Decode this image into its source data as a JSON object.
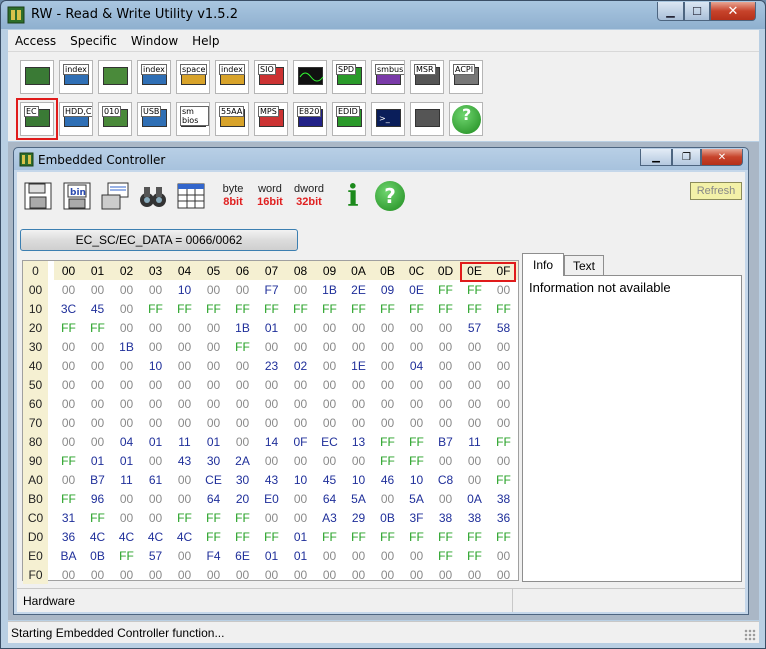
{
  "window": {
    "title": "RW - Read & Write Utility v1.5.2"
  },
  "menu": [
    "Access",
    "Specific",
    "Window",
    "Help"
  ],
  "toolbar": {
    "row1": [
      {
        "name": "pci",
        "label": ""
      },
      {
        "name": "pci-index",
        "label": "index"
      },
      {
        "name": "memory",
        "label": ""
      },
      {
        "name": "memory-index",
        "label": "index"
      },
      {
        "name": "io-space",
        "label": "space"
      },
      {
        "name": "io-index",
        "label": "index"
      },
      {
        "name": "superio",
        "label": "SIO"
      },
      {
        "name": "oscilloscope",
        "label": ""
      },
      {
        "name": "spd",
        "label": "SPD"
      },
      {
        "name": "smbus",
        "label": "smbus"
      },
      {
        "name": "msr",
        "label": "MSR"
      },
      {
        "name": "acpi",
        "label": "ACPI"
      }
    ],
    "row2": [
      {
        "name": "ec",
        "label": "EC"
      },
      {
        "name": "hdd-cd",
        "label": "HDD,CD"
      },
      {
        "name": "disk",
        "label": "010"
      },
      {
        "name": "usb",
        "label": "USB"
      },
      {
        "name": "smbios",
        "label": "sm bios"
      },
      {
        "name": "55aa",
        "label": "55AA"
      },
      {
        "name": "mps",
        "label": "MPS"
      },
      {
        "name": "e820",
        "label": "E820"
      },
      {
        "name": "edid",
        "label": "EDID"
      },
      {
        "name": "command",
        "label": ""
      },
      {
        "name": "tools",
        "label": ""
      },
      {
        "name": "help",
        "label": "?"
      }
    ]
  },
  "child": {
    "title": "Embedded Controller",
    "toolbar": {
      "byte": {
        "t": "byte",
        "b": "8bit"
      },
      "word": {
        "t": "word",
        "b": "16bit"
      },
      "dword": {
        "t": "dword",
        "b": "32bit"
      },
      "info": "i",
      "help": "?",
      "refresh": "Refresh"
    },
    "address_button": "EC_SC/EC_DATA = 0066/0062",
    "grid": {
      "corner": "0",
      "columns": [
        "00",
        "01",
        "02",
        "03",
        "04",
        "05",
        "06",
        "07",
        "08",
        "09",
        "0A",
        "0B",
        "0C",
        "0D",
        "0E",
        "0F"
      ],
      "rows": [
        {
          "h": "00",
          "v": [
            "00",
            "00",
            "00",
            "00",
            "10",
            "00",
            "00",
            "F7",
            "00",
            "1B",
            "2E",
            "09",
            "0E",
            "FF",
            "FF",
            "00"
          ]
        },
        {
          "h": "10",
          "v": [
            "3C",
            "45",
            "00",
            "FF",
            "FF",
            "FF",
            "FF",
            "FF",
            "FF",
            "FF",
            "FF",
            "FF",
            "FF",
            "FF",
            "FF",
            "FF"
          ]
        },
        {
          "h": "20",
          "v": [
            "FF",
            "FF",
            "00",
            "00",
            "00",
            "00",
            "1B",
            "01",
            "00",
            "00",
            "00",
            "00",
            "00",
            "00",
            "57",
            "58"
          ]
        },
        {
          "h": "30",
          "v": [
            "00",
            "00",
            "1B",
            "00",
            "00",
            "00",
            "FF",
            "00",
            "00",
            "00",
            "00",
            "00",
            "00",
            "00",
            "00",
            "00"
          ]
        },
        {
          "h": "40",
          "v": [
            "00",
            "00",
            "00",
            "10",
            "00",
            "00",
            "00",
            "23",
            "02",
            "00",
            "1E",
            "00",
            "04",
            "00",
            "00",
            "00"
          ]
        },
        {
          "h": "50",
          "v": [
            "00",
            "00",
            "00",
            "00",
            "00",
            "00",
            "00",
            "00",
            "00",
            "00",
            "00",
            "00",
            "00",
            "00",
            "00",
            "00"
          ]
        },
        {
          "h": "60",
          "v": [
            "00",
            "00",
            "00",
            "00",
            "00",
            "00",
            "00",
            "00",
            "00",
            "00",
            "00",
            "00",
            "00",
            "00",
            "00",
            "00"
          ]
        },
        {
          "h": "70",
          "v": [
            "00",
            "00",
            "00",
            "00",
            "00",
            "00",
            "00",
            "00",
            "00",
            "00",
            "00",
            "00",
            "00",
            "00",
            "00",
            "00"
          ]
        },
        {
          "h": "80",
          "v": [
            "00",
            "00",
            "04",
            "01",
            "11",
            "01",
            "00",
            "14",
            "0F",
            "EC",
            "13",
            "FF",
            "FF",
            "B7",
            "11",
            "FF"
          ]
        },
        {
          "h": "90",
          "v": [
            "FF",
            "01",
            "01",
            "00",
            "43",
            "30",
            "2A",
            "00",
            "00",
            "00",
            "00",
            "FF",
            "FF",
            "00",
            "00",
            "00"
          ]
        },
        {
          "h": "A0",
          "v": [
            "00",
            "B7",
            "11",
            "61",
            "00",
            "CE",
            "30",
            "43",
            "10",
            "45",
            "10",
            "46",
            "10",
            "C8",
            "00",
            "FF"
          ]
        },
        {
          "h": "B0",
          "v": [
            "FF",
            "96",
            "00",
            "00",
            "00",
            "64",
            "20",
            "E0",
            "00",
            "64",
            "5A",
            "00",
            "5A",
            "00",
            "0A",
            "38"
          ]
        },
        {
          "h": "C0",
          "v": [
            "31",
            "FF",
            "00",
            "00",
            "FF",
            "FF",
            "FF",
            "00",
            "00",
            "A3",
            "29",
            "0B",
            "3F",
            "38",
            "38",
            "36"
          ]
        },
        {
          "h": "D0",
          "v": [
            "36",
            "4C",
            "4C",
            "4C",
            "4C",
            "FF",
            "FF",
            "FF",
            "01",
            "FF",
            "FF",
            "FF",
            "FF",
            "FF",
            "FF",
            "FF"
          ]
        },
        {
          "h": "E0",
          "v": [
            "BA",
            "0B",
            "FF",
            "57",
            "00",
            "F4",
            "6E",
            "01",
            "01",
            "00",
            "00",
            "00",
            "00",
            "FF",
            "FF",
            "00"
          ]
        },
        {
          "h": "F0",
          "v": [
            "00",
            "00",
            "00",
            "00",
            "00",
            "00",
            "00",
            "00",
            "00",
            "00",
            "00",
            "00",
            "00",
            "00",
            "00",
            "00"
          ]
        }
      ]
    },
    "tabs": [
      "Info",
      "Text"
    ],
    "info_text": "Information not available",
    "status": "Hardware"
  },
  "statusbar": "Starting Embedded Controller function...",
  "colors": {
    "zero": "#8a8a8a",
    "ff": "#25a025",
    "value": "#1f2f9a",
    "highlight": "#e01b1b"
  }
}
